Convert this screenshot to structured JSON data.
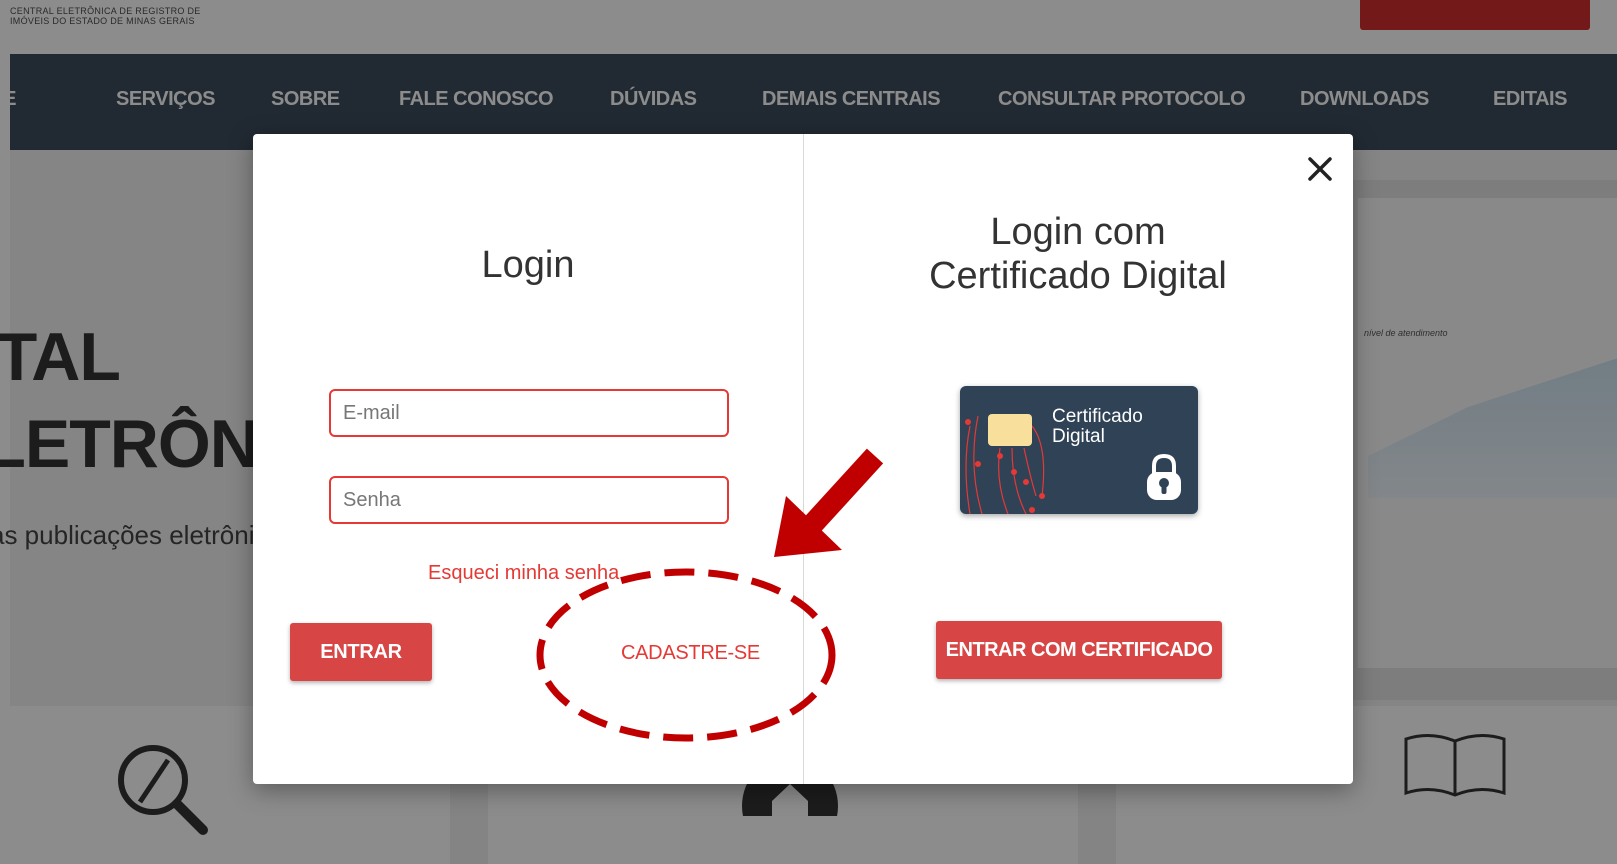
{
  "site": {
    "logo_line1": "CENTRAL ELETRÔNICA DE REGISTRO DE",
    "logo_line2": "IMÓVEIS DO ESTADO DE MINAS GERAIS"
  },
  "nav": {
    "items": [
      "HOME",
      "SERVIÇOS",
      "SOBRE",
      "FALE CONOSCO",
      "DÚVIDAS",
      "DEMAIS CENTRAIS",
      "CONSULTAR PROTOCOLO",
      "DOWNLOADS",
      "EDITAIS"
    ]
  },
  "hero": {
    "line1": "DIGITAL",
    "line2": "ELETRÔNICO",
    "subtitle": "as publicações eletrônicas",
    "chart_caption": "nível de atendimento"
  },
  "login": {
    "title": "Login",
    "email_placeholder": "E-mail",
    "password_placeholder": "Senha",
    "forgot_password": "Esqueci minha senha",
    "enter_button": "ENTRAR",
    "signup_link": "CADASTRE-SE"
  },
  "certificate": {
    "title_line1": "Login com",
    "title_line2": "Certificado Digital",
    "card_label_1": "Certificado",
    "card_label_2": "Digital",
    "enter_button": "ENTRAR COM CERTIFICADO"
  },
  "colors": {
    "accent": "#d84545",
    "nav_background": "#3d4c5b",
    "annotation": "#c00000",
    "card_background": "#2f4256",
    "card_chip": "#f8e09c"
  },
  "icons": [
    "close-icon",
    "search-feature-icon",
    "home-feature-icon",
    "book-feature-icon",
    "lock-icon",
    "chip-icon",
    "arrow-annotation",
    "dashed-ellipse-annotation"
  ]
}
